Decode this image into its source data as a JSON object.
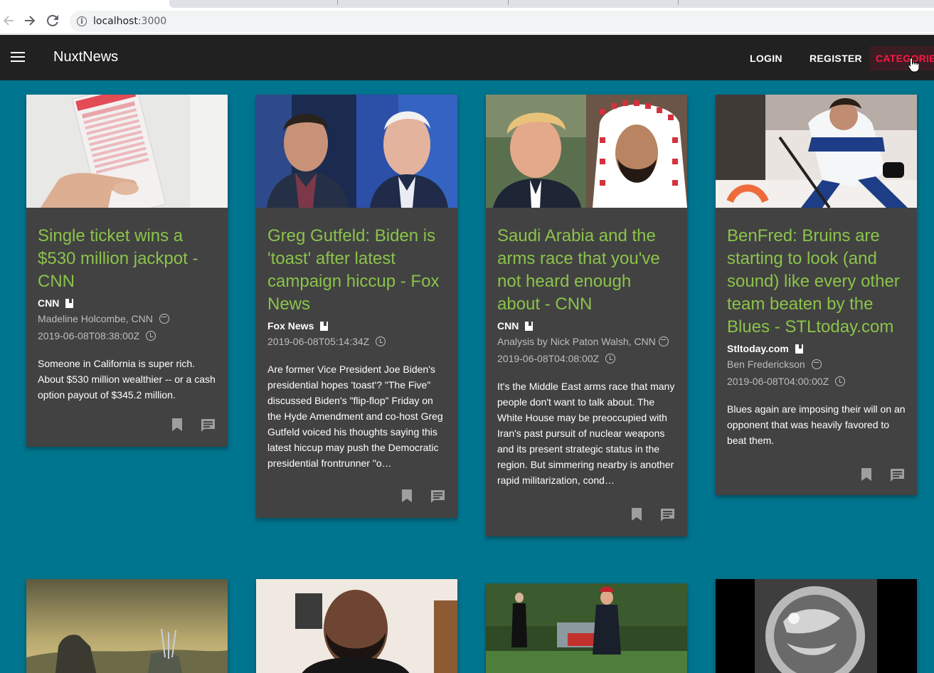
{
  "browser": {
    "url_host": "localhost",
    "url_port": ":3000"
  },
  "appbar": {
    "title": "NuxtNews",
    "login_label": "LOGIN",
    "register_label": "REGISTER",
    "categories_label": "CATEGORIES",
    "accent_color": "#ff1744",
    "background_color": "#212121"
  },
  "theme": {
    "page_background": "#00758f",
    "card_background": "#424242",
    "title_color": "#8bc34a"
  },
  "articles": [
    {
      "title": "Single ticket wins a $530 million jackpot - CNN",
      "source": "CNN",
      "author": "Madeline Holcombe, CNN",
      "published": "2019-06-08T08:38:00Z",
      "description": "Someone in California is super rich. About $530 million wealthier -- or a cash option payout of $345.2 million.",
      "image": "lottery-ticket-photo"
    },
    {
      "title": "Greg Gutfeld: Biden is 'toast' after latest campaign hiccup - Fox News",
      "source": "Fox News",
      "author": "",
      "published": "2019-06-08T05:14:34Z",
      "description": "Are former Vice President Joe Biden's presidential hopes 'toast'? \"The Five\" discussed Biden's \"flip-flop\" Friday on the Hyde Amendment and co-host Greg Gutfeld  voiced his thoughts saying this latest hiccup may push the Democratic presidential frontrunner \"o…",
      "image": "gutfeld-biden-photo"
    },
    {
      "title": "Saudi Arabia and the arms race that you've not heard enough about - CNN",
      "source": "CNN",
      "author": "Analysis by Nick Paton Walsh, CNN",
      "published": "2019-06-08T04:08:00Z",
      "description": "It's the Middle East arms race that many people don't want to talk about. The White House may be preoccupied with Iran's past pursuit of nuclear weapons and its present strategic status in the region. But simmering nearby is another rapid militarization, cond…",
      "image": "trump-mbs-photo"
    },
    {
      "title": "BenFred: Bruins are starting to look (and sound) like every other team beaten by the Blues - STLtoday.com",
      "source": "Stltoday.com",
      "author": "Ben Frederickson",
      "published": "2019-06-08T04:00:00Z",
      "description": "Blues again are imposing their will on an opponent that was heavily favored to beat them.",
      "image": "hockey-photo"
    }
  ]
}
